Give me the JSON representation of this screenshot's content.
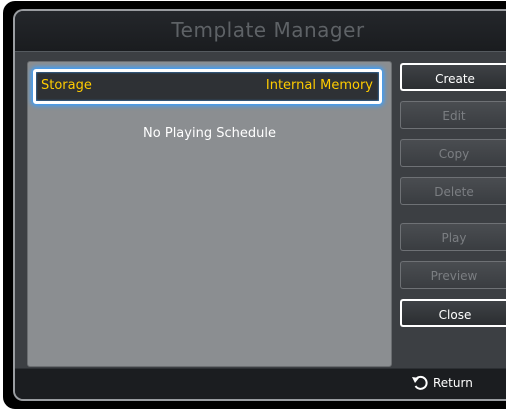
{
  "window": {
    "title": "Template Manager"
  },
  "list": {
    "storage_label": "Storage",
    "storage_value": "Internal Memory",
    "empty_message": "No Playing Schedule"
  },
  "buttons": [
    {
      "label": "Create",
      "enabled": true
    },
    {
      "label": "Edit",
      "enabled": false
    },
    {
      "label": "Copy",
      "enabled": false
    },
    {
      "label": "Delete",
      "enabled": false
    },
    {
      "label": "Play",
      "enabled": false
    },
    {
      "label": "Preview",
      "enabled": false
    },
    {
      "label": "Close",
      "enabled": true
    }
  ],
  "footer": {
    "return_label": "Return",
    "return_icon": "return-arrow-icon"
  },
  "colors": {
    "highlight_text": "#ffcc00",
    "focus_glow": "#3aa0ff",
    "panel_bg": "#8b8e91"
  }
}
